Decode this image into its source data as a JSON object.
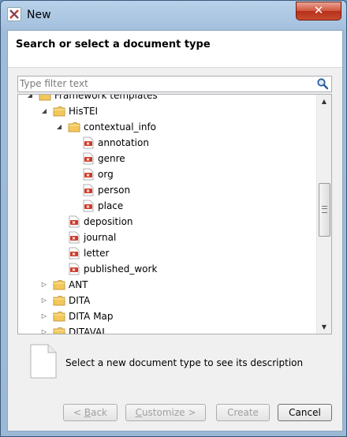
{
  "window": {
    "title": "New",
    "close_glyph": "✕"
  },
  "header": {
    "title": "Search or select a document type"
  },
  "filter": {
    "placeholder": "Type filter text",
    "value": ""
  },
  "tree": {
    "items": [
      {
        "label": "Framework templates",
        "type": "folder",
        "expanded": true,
        "level": 0
      },
      {
        "label": "HisTEI",
        "type": "folder",
        "expanded": true,
        "level": 1
      },
      {
        "label": "contextual_info",
        "type": "folder",
        "expanded": true,
        "level": 2
      },
      {
        "label": "annotation",
        "type": "file",
        "level": 3
      },
      {
        "label": "genre",
        "type": "file",
        "level": 3
      },
      {
        "label": "org",
        "type": "file",
        "level": 3
      },
      {
        "label": "person",
        "type": "file",
        "level": 3
      },
      {
        "label": "place",
        "type": "file",
        "level": 3
      },
      {
        "label": "deposition",
        "type": "file",
        "level": 2
      },
      {
        "label": "journal",
        "type": "file",
        "level": 2
      },
      {
        "label": "letter",
        "type": "file",
        "level": 2
      },
      {
        "label": "published_work",
        "type": "file",
        "level": 2
      },
      {
        "label": "ANT",
        "type": "folder",
        "expanded": false,
        "level": 1
      },
      {
        "label": "DITA",
        "type": "folder",
        "expanded": false,
        "level": 1
      },
      {
        "label": "DITA Map",
        "type": "folder",
        "expanded": false,
        "level": 1
      },
      {
        "label": "DITAVAL",
        "type": "folder",
        "expanded": false,
        "level": 1
      }
    ]
  },
  "description": {
    "text": "Select a new document type to see its description"
  },
  "buttons": {
    "back": {
      "prefix": "< ",
      "mnemonic": "B",
      "rest": "ack"
    },
    "customize": {
      "mnemonic": "C",
      "rest": "ustomize >"
    },
    "create": "Create",
    "cancel": "Cancel"
  },
  "colors": {
    "folder": "#f3c85a",
    "file_badge": "#d23a2a",
    "close_button": "#c94a2f"
  },
  "icons": {
    "app": "oxygen-app-icon",
    "search": "search-icon",
    "folder": "folder-icon",
    "file": "xml-file-icon"
  }
}
